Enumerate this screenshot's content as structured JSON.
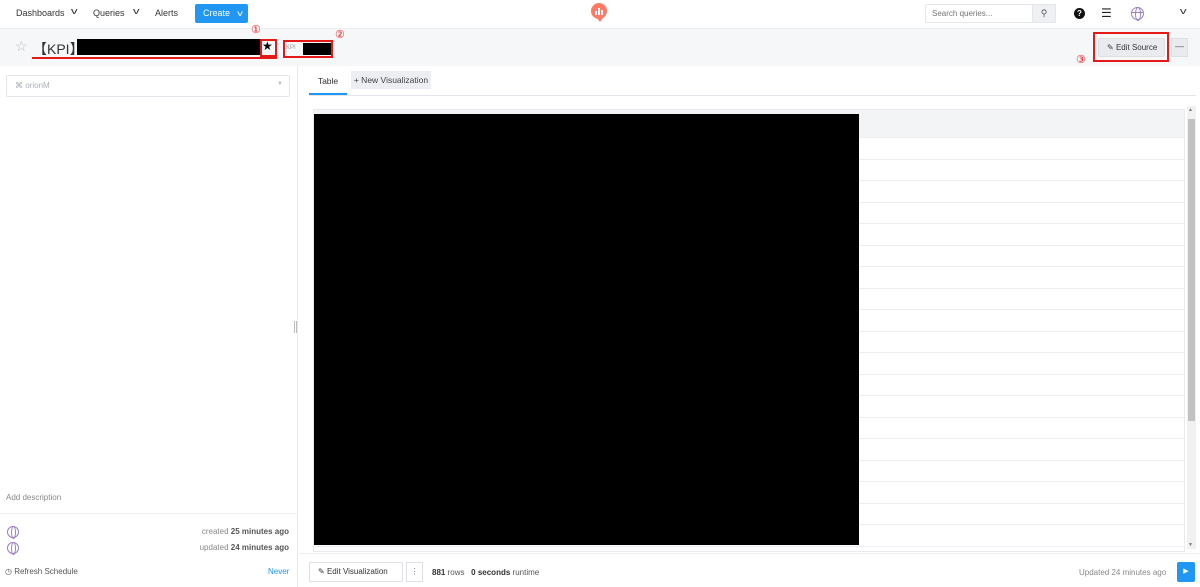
{
  "nav": {
    "dashboards": "Dashboards",
    "queries": "Queries",
    "alerts": "Alerts",
    "create": "Create",
    "search_placeholder": "Search queries...",
    "search_icon": "magnifier-icon",
    "help_icon": "?",
    "settings_icon": "sliders-icon"
  },
  "query": {
    "title_prefix": "【KPI】",
    "tag_label": "KPI",
    "edit_source": "Edit Source",
    "more": "—"
  },
  "annotations": {
    "one": "①",
    "two": "②",
    "three": "③"
  },
  "left": {
    "datasource_placeholder": "orionM",
    "add_description": "Add description",
    "created_label": "created",
    "created_time": "25 minutes ago",
    "updated_label": "updated",
    "updated_time": "24 minutes ago",
    "refresh_schedule": "Refresh Schedule",
    "refresh_value": "Never"
  },
  "right": {
    "tab_table": "Table",
    "tab_new_viz": "+ New Visualization",
    "edit_visualization": "Edit Visualization",
    "more": "⋮",
    "rows_count": "881",
    "rows_label": "rows",
    "runtime_value": "0 seconds",
    "runtime_label": "runtime",
    "updated_text": "Updated 24 minutes ago",
    "execute_icon": "▶"
  },
  "colors": {
    "accent": "#2196f3",
    "annotation_red": "#e61919",
    "logo": "#ff7964"
  }
}
